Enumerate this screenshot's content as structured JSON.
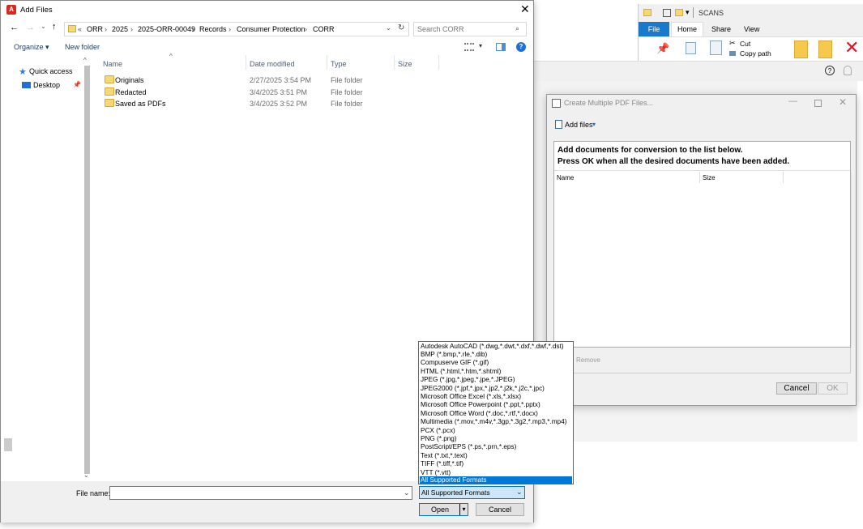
{
  "bg_explorer": {
    "title": "SCANS",
    "tabs": [
      "File",
      "Home",
      "Share",
      "View"
    ],
    "cut_label": "Cut",
    "copy_path_label": "Copy path"
  },
  "pdf_dialog": {
    "title": "Create Multiple PDF Files...",
    "add_files_label": "Add files",
    "instruction_line1": "Add documents for conversion to the list below.",
    "instruction_line2": "Press OK when all the desired documents have been added.",
    "col_name": "Name",
    "col_size": "Size",
    "remove_label": "Remove",
    "cancel_label": "Cancel",
    "ok_label": "OK"
  },
  "add_files": {
    "title": "Add Files",
    "breadcrumb": [
      "ORR",
      "2025",
      "2025-ORR-00049",
      "Records",
      "Consumer Protection",
      "CORR"
    ],
    "search_placeholder": "Search CORR",
    "organize_label": "Organize",
    "new_folder_label": "New folder",
    "nav": {
      "quick_access": "Quick access",
      "desktop": "Desktop"
    },
    "columns": {
      "name": "Name",
      "date": "Date modified",
      "type": "Type",
      "size": "Size"
    },
    "files": [
      {
        "name": "Originals",
        "date": "2/27/2025 3:54 PM",
        "type": "File folder"
      },
      {
        "name": "Redacted",
        "date": "3/4/2025 3:51 PM",
        "type": "File folder"
      },
      {
        "name": "Saved as PDFs",
        "date": "3/4/2025 3:52 PM",
        "type": "File folder"
      }
    ],
    "file_name_label": "File name:",
    "file_name_value": "",
    "file_type_selected": "All Supported Formats",
    "open_label": "Open",
    "cancel_label": "Cancel",
    "file_type_options": [
      "Autodesk AutoCAD (*.dwg,*.dwt,*.dxf,*.dwf,*.dst)",
      "BMP (*.bmp,*.rle,*.dib)",
      "Compuserve GIF (*.gif)",
      "HTML (*.html,*.htm,*.shtml)",
      "JPEG (*.jpg,*.jpeg,*.jpe,*.JPEG)",
      "JPEG2000 (*.jpf,*.jpx,*.jp2,*.j2k,*.j2c,*.jpc)",
      "Microsoft Office Excel (*.xls,*.xlsx)",
      "Microsoft Office Powerpoint (*.ppt,*.pptx)",
      "Microsoft Office Word (*.doc,*.rtf,*.docx)",
      "Multimedia (*.mov,*.m4v,*.3gp,*.3g2,*.mp3,*.mp4)",
      "PCX (*.pcx)",
      "PNG (*.png)",
      "PostScript/EPS (*.ps,*.prn,*.eps)",
      "Text (*.txt,*.text)",
      "TIFF (*.tiff,*.tif)",
      "VTT (*.vtt)",
      "All Supported Formats"
    ]
  },
  "colors": {
    "accent": "#0078d7",
    "acrobat_red": "#d7291f",
    "folder": "#f8d775"
  }
}
